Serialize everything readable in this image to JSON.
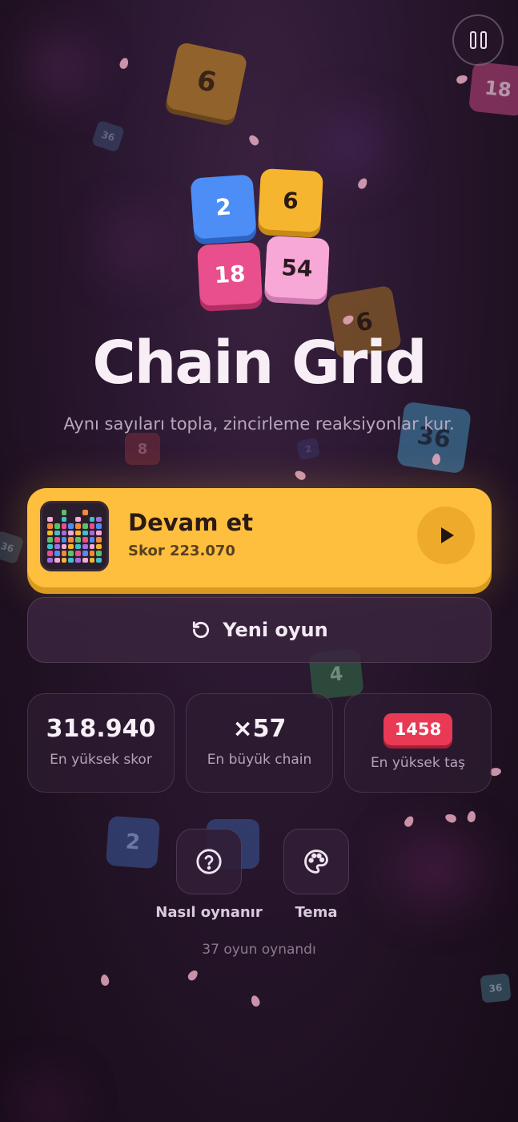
{
  "app": {
    "title": "Chain Grid",
    "subtitle": "Aynı sayıları topla, zincirleme reaksiyonlar kur."
  },
  "logo_tiles": [
    {
      "value": "2",
      "color": "#4c8ef5"
    },
    {
      "value": "6",
      "color": "#f6b52e"
    },
    {
      "value": "18",
      "color": "#e84f8c"
    },
    {
      "value": "54",
      "color": "#f7a8d6"
    }
  ],
  "background_tiles": [
    "6",
    "18",
    "36",
    "6",
    "36",
    "8",
    "2",
    "36",
    "4",
    "2",
    "36"
  ],
  "continue": {
    "label": "Devam et",
    "score": "Skor 223.070"
  },
  "new_game": {
    "label": "Yeni oyun"
  },
  "stats": {
    "high_score": {
      "value": "318.940",
      "label": "En yüksek skor"
    },
    "biggest_chain": {
      "value": "×57",
      "label": "En büyük chain"
    },
    "highest_tile": {
      "value": "1458",
      "label": "En yüksek taş"
    }
  },
  "actions": {
    "how_to_play": "Nasıl oynanır",
    "theme": "Tema"
  },
  "games_played": "37 oyun oynandı",
  "icons": {
    "pause": "pause-icon",
    "play": "play-icon",
    "restart": "restart-icon",
    "help": "question-circle-icon",
    "theme": "palette-icon"
  },
  "colors": {
    "accent": "#fdbf3d",
    "badge_red": "#e83a55",
    "background": "#241427"
  }
}
